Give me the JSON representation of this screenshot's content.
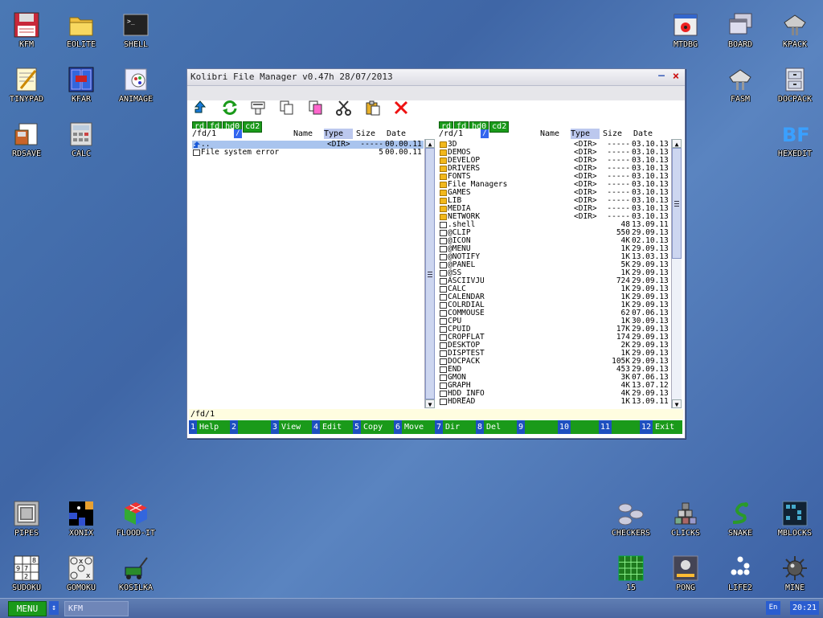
{
  "desktop_icons": [
    {
      "label": "KFM",
      "icon": "floppy-icon"
    },
    {
      "label": "EOLITE",
      "icon": "folder-icon"
    },
    {
      "label": "SHELL",
      "icon": "terminal-icon"
    },
    {
      "label": "TINYPAD",
      "icon": "notepad-icon"
    },
    {
      "label": "KFAR",
      "icon": "kfar-icon"
    },
    {
      "label": "ANIMAGE",
      "icon": "paint-icon"
    },
    {
      "label": "RDSAVE",
      "icon": "rdsave-icon"
    },
    {
      "label": "CALC",
      "icon": "calculator-icon"
    },
    {
      "label": "MTDBG",
      "icon": "bug-icon"
    },
    {
      "label": "BOARD",
      "icon": "windows-icon"
    },
    {
      "label": "KPACK",
      "icon": "kpack-icon"
    },
    {
      "label": "FASM",
      "icon": "fasm-icon"
    },
    {
      "label": "DOCPACK",
      "icon": "cabinet-icon"
    },
    {
      "label": "HEXEDIT",
      "icon": "hexedit-icon"
    },
    {
      "label": "PIPES",
      "icon": "pipes-icon"
    },
    {
      "label": "XONIX",
      "icon": "xonix-icon"
    },
    {
      "label": "FLOOD-IT",
      "icon": "cube-icon"
    },
    {
      "label": "SUDOKU",
      "icon": "sudoku-icon"
    },
    {
      "label": "GOMOKU",
      "icon": "gomoku-icon"
    },
    {
      "label": "KOSILKA",
      "icon": "mower-icon"
    },
    {
      "label": "CHECKERS",
      "icon": "checkers-icon"
    },
    {
      "label": "CLICKS",
      "icon": "blocks-icon"
    },
    {
      "label": "SNAKE",
      "icon": "snake-icon"
    },
    {
      "label": "MBLOCKS",
      "icon": "grid-icon"
    },
    {
      "label": "15",
      "icon": "fifteen-icon"
    },
    {
      "label": "PONG",
      "icon": "pong-icon"
    },
    {
      "label": "LIFE2",
      "icon": "life-icon"
    },
    {
      "label": "MINE",
      "icon": "mine-icon"
    }
  ],
  "window": {
    "title": "Kolibri File Manager v0.47h 28/07/2013",
    "minimize": "–",
    "close": "×"
  },
  "toolbar": [
    "up-arrow-icon",
    "refresh-icon",
    "copy-folder-icon",
    "copy-icon",
    "paste-doc-icon",
    "cut-icon",
    "clipboard-icon",
    "delete-icon"
  ],
  "drives": [
    "rd",
    "fd",
    "hd0",
    "cd2"
  ],
  "left_panel": {
    "path": "/fd/1",
    "slash": "/",
    "columns": {
      "name": "Name",
      "type": "Type",
      "size": "Size",
      "date": "Date"
    },
    "rows": [
      {
        "name": "..",
        "type": "<DIR>",
        "size": "-----",
        "date": "00.00.11",
        "kind": "up"
      },
      {
        "name": "File system error",
        "type": "",
        "size": "5",
        "date": "00.00.11",
        "kind": "file"
      }
    ]
  },
  "right_panel": {
    "path": "/rd/1",
    "slash": "/",
    "columns": {
      "name": "Name",
      "type": "Type",
      "size": "Size",
      "date": "Date"
    },
    "rows": [
      {
        "name": "3D",
        "type": "<DIR>",
        "size": "-----",
        "date": "03.10.13",
        "kind": "dir"
      },
      {
        "name": "DEMOS",
        "type": "<DIR>",
        "size": "-----",
        "date": "03.10.13",
        "kind": "dir"
      },
      {
        "name": "DEVELOP",
        "type": "<DIR>",
        "size": "-----",
        "date": "03.10.13",
        "kind": "dir"
      },
      {
        "name": "DRIVERS",
        "type": "<DIR>",
        "size": "-----",
        "date": "03.10.13",
        "kind": "dir"
      },
      {
        "name": "FONTS",
        "type": "<DIR>",
        "size": "-----",
        "date": "03.10.13",
        "kind": "dir"
      },
      {
        "name": "File Managers",
        "type": "<DIR>",
        "size": "-----",
        "date": "03.10.13",
        "kind": "dir"
      },
      {
        "name": "GAMES",
        "type": "<DIR>",
        "size": "-----",
        "date": "03.10.13",
        "kind": "dir"
      },
      {
        "name": "LIB",
        "type": "<DIR>",
        "size": "-----",
        "date": "03.10.13",
        "kind": "dir"
      },
      {
        "name": "MEDIA",
        "type": "<DIR>",
        "size": "-----",
        "date": "03.10.13",
        "kind": "dir"
      },
      {
        "name": "NETWORK",
        "type": "<DIR>",
        "size": "-----",
        "date": "03.10.13",
        "kind": "dir"
      },
      {
        "name": ".shell",
        "type": "",
        "size": "48",
        "date": "13.09.11",
        "kind": "file"
      },
      {
        "name": "@CLIP",
        "type": "",
        "size": "550",
        "date": "29.09.13",
        "kind": "file"
      },
      {
        "name": "@ICON",
        "type": "",
        "size": "4K",
        "date": "02.10.13",
        "kind": "file"
      },
      {
        "name": "@MENU",
        "type": "",
        "size": "1K",
        "date": "29.09.13",
        "kind": "file"
      },
      {
        "name": "@NOTIFY",
        "type": "",
        "size": "1K",
        "date": "13.03.13",
        "kind": "file"
      },
      {
        "name": "@PANEL",
        "type": "",
        "size": "5K",
        "date": "29.09.13",
        "kind": "file"
      },
      {
        "name": "@SS",
        "type": "",
        "size": "1K",
        "date": "29.09.13",
        "kind": "file"
      },
      {
        "name": "ASCIIVJU",
        "type": "",
        "size": "724",
        "date": "29.09.13",
        "kind": "file"
      },
      {
        "name": "CALC",
        "type": "",
        "size": "1K",
        "date": "29.09.13",
        "kind": "file"
      },
      {
        "name": "CALENDAR",
        "type": "",
        "size": "1K",
        "date": "29.09.13",
        "kind": "file"
      },
      {
        "name": "COLRDIAL",
        "type": "",
        "size": "1K",
        "date": "29.09.13",
        "kind": "file"
      },
      {
        "name": "COMMOUSE",
        "type": "",
        "size": "62",
        "date": "07.06.13",
        "kind": "file"
      },
      {
        "name": "CPU",
        "type": "",
        "size": "1K",
        "date": "30.09.13",
        "kind": "file"
      },
      {
        "name": "CPUID",
        "type": "",
        "size": "17K",
        "date": "29.09.13",
        "kind": "file"
      },
      {
        "name": "CROPFLAT",
        "type": "",
        "size": "174",
        "date": "29.09.13",
        "kind": "file"
      },
      {
        "name": "DESKTOP",
        "type": "",
        "size": "2K",
        "date": "29.09.13",
        "kind": "file"
      },
      {
        "name": "DISPTEST",
        "type": "",
        "size": "1K",
        "date": "29.09.13",
        "kind": "file"
      },
      {
        "name": "DOCPACK",
        "type": "",
        "size": "105K",
        "date": "29.09.13",
        "kind": "file"
      },
      {
        "name": "END",
        "type": "",
        "size": "453",
        "date": "29.09.13",
        "kind": "file"
      },
      {
        "name": "GMON",
        "type": "",
        "size": "3K",
        "date": "07.06.13",
        "kind": "file"
      },
      {
        "name": "GRAPH",
        "type": "",
        "size": "4K",
        "date": "13.07.12",
        "kind": "file"
      },
      {
        "name": "HDD_INFO",
        "type": "",
        "size": "4K",
        "date": "29.09.13",
        "kind": "file"
      },
      {
        "name": "HDREAD",
        "type": "",
        "size": "1K",
        "date": "13.09.11",
        "kind": "file"
      }
    ]
  },
  "command_line": "/fd/1",
  "fkeys": [
    {
      "n": "1",
      "label": "Help"
    },
    {
      "n": "2",
      "label": ""
    },
    {
      "n": "3",
      "label": "View"
    },
    {
      "n": "4",
      "label": "Edit"
    },
    {
      "n": "5",
      "label": "Copy"
    },
    {
      "n": "6",
      "label": "Move"
    },
    {
      "n": "7",
      "label": "Dir"
    },
    {
      "n": "8",
      "label": "Del"
    },
    {
      "n": "9",
      "label": ""
    },
    {
      "n": "10",
      "label": ""
    },
    {
      "n": "11",
      "label": ""
    },
    {
      "n": "12",
      "label": "Exit"
    }
  ],
  "taskbar": {
    "menu": "MENU",
    "switch": "↕",
    "task": "KFM",
    "lang": "En",
    "clock": "20:21"
  }
}
